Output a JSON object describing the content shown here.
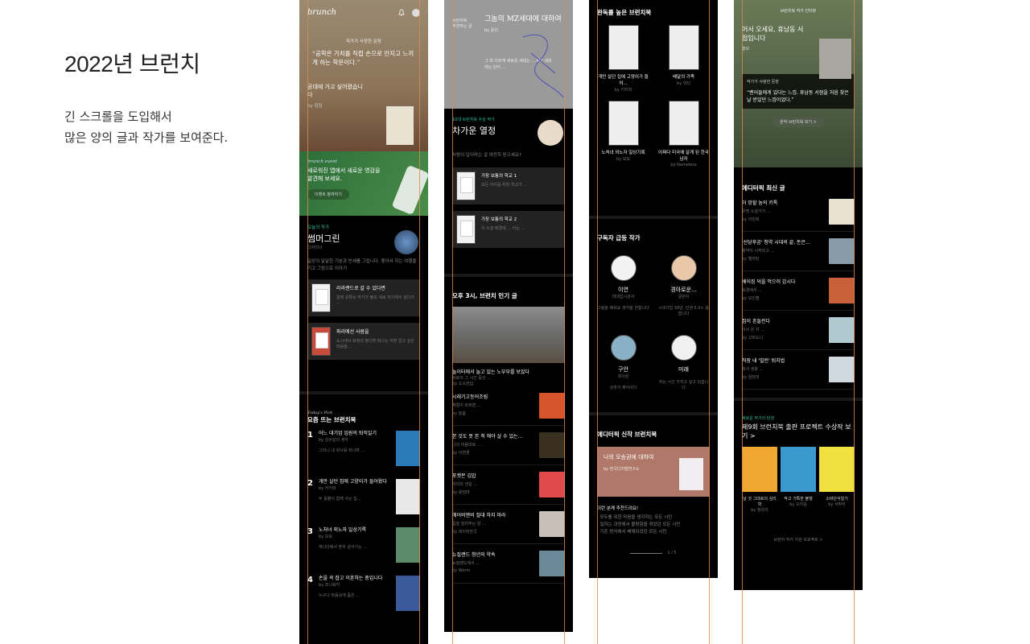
{
  "intro": {
    "title": "2022년 브런치",
    "lines": [
      "긴 스크롤을 도입해서",
      "많은 양의 글과 작가를 보여준다."
    ]
  },
  "col1": {
    "logo": "brunch",
    "hero_tag": "작가가 사랑한 문장",
    "hero_quote": "“공학은 가치를 직접 손으로 만지고 느끼게 하는 학문이다.”",
    "hero_sub": "공대에 가고 싶어졌습니다",
    "hero_author": "by 킴킴",
    "event_tag": "brunch event",
    "event_title": "새로워진 앱에서 새로운 영감을 발견해 보세요.",
    "event_btn": "이벤트 참여하기",
    "today_tag": "오늘의 작가",
    "today_name": "썸머그린",
    "today_job": "디자이너",
    "today_desc": "일상의 달달한 기분과 빈세를 그립니다. 좋아서 하는 여행을 기고 그림으로 이야기",
    "cards": [
      {
        "title": "라라랜드로 갈 수 있다면",
        "desc": "일에 유튜브 작가가 불쑥 새로 여기에서 살다가 ..."
      },
      {
        "title": "파리에선 사람을",
        "desc": "도시에서 표정의 참다면 떠나는 어떤 알고 싶은 마음을..."
      }
    ],
    "pick_tag": "Today's Pick",
    "pick_title": "요즘 뜨는 브런치북",
    "picks": [
      {
        "n": "1",
        "title": "어느 대기업 임원의 퇴직일기",
        "by": "by 김수달의 생각",
        "desc": "그러니 내 회사를 떠나며 ..."
      },
      {
        "n": "2",
        "title": "개만 살던 집에 고양이가 들어왔다",
        "by": "by 키키와",
        "desc": "두 동물이 함께 사는 집..."
      },
      {
        "n": "3",
        "title": "노처녀 외노자 일상기록",
        "by": "by 모모",
        "desc": "캐나다에서 혼자 살아가는 ..."
      },
      {
        "n": "4",
        "title": "손을 꼭 잡고 이혼하는 중입니다",
        "by": "by 조니워커",
        "desc": "누구나 마음속에 품은 ..."
      }
    ]
  },
  "col2": {
    "hero_small1": "브런치북",
    "hero_small2": "추천하는 글",
    "hero_title": "그놈의 MZ세대에 대하여",
    "hero_author": "by 윤리",
    "hero_desc": "그 회 다르게 새로운 세대는 ... MZ 세대라는 단어 ...",
    "award_tag": "10대 브런치북 수상 작가",
    "award_name": "차가운 열정",
    "award_q": "사람이 답이라는 걸 여전히 믿으세요?",
    "cards": [
      {
        "title": "가장 보통의 학교 1",
        "desc": "모든 아이를 위한 학교가 ..."
      },
      {
        "title": "가장 보통의 학교 2",
        "desc": "이 소설 배경에 ... 라는 ..."
      }
    ],
    "pop_title": "오후 3시, 브런치 인기 글",
    "pop_main": "놀이터에서 놀고 있는 노부부를 보았다",
    "pop_main_desc": "서로의 그 시간 동안 ...",
    "pop_main_by": "by 오소한집",
    "items": [
      {
        "title": "시래기고등어조림",
        "desc": "계절이 바뀌면 ...",
        "by": "by 늘봄"
      },
      {
        "title": "본 것도 못 본 척 해야 살 수 있는...",
        "desc": "나의 마음대로 ...",
        "by": "by 이연경"
      },
      {
        "title": "포켓몬 김밥",
        "desc": "아이의 생일 ...",
        "by": "by 용엄마"
      },
      {
        "title": "에어비앤비 절대 하지 마라",
        "desc": "집을 빌려주는 일 ...",
        "by": "by 데이빗한국"
      },
      {
        "title": "뉴질랜드 청년의 약속",
        "desc": "뉴질랜드에서 ...",
        "by": "by Worm"
      }
    ]
  },
  "col3": {
    "done_title": "완독률 높은 브런치북",
    "books": [
      {
        "title": "개만 살던 집에 고양이가 들어...",
        "by": "by 키키와"
      },
      {
        "title": "배달의 가족",
        "by": "by 빅터"
      },
      {
        "title": "노처녀 외노자 일상기록",
        "by": "by 모모"
      },
      {
        "title": "어쩌다 미국에 살게 된 한국 남자",
        "by": "by Nameless"
      }
    ],
    "sub_title": "구독자 급등 작가",
    "writers": [
      {
        "name": "이연",
        "job": "미대입시강사",
        "desc": "그림을 배워요 생각을 전합니다"
      },
      {
        "name": "경아로운...",
        "job": "글쓴이",
        "desc": "<대기업 30년, 인생 5.0> 를 씁니다"
      },
      {
        "name": "구안",
        "job": "회사원",
        "desc": "상추가 채식이다"
      },
      {
        "name": "미래",
        "job": "",
        "desc": "자는 시간 가지고 싶고 있습니다"
      }
    ],
    "new_title": "에디터픽 신작 브런치북",
    "new_book": "나의 오송권에 대하여",
    "new_by": "by 한국디지털연구소",
    "rec_head": "이런 분께 추천드려요!",
    "rec": [
      "· 모두를 위한 마음을 생각하는 모든 시민",
      "· 일하는 과정에서 불편함을 겪었던 모든 시민",
      "· 기존 방식에서 배제되었던 모든 시민"
    ],
    "pager": "1 / 5"
  },
  "col4": {
    "hero_tag": "브런치북 작가 인터뷰",
    "hero_title": "어서 오세요, 휴남동 서점입니다",
    "hero_by": "황보",
    "quote_tag": "작가가 사랑한 문장",
    "quote": "“벤어들에게 있다는 느낌. 휴남동 서점을 처음 찾은 날 받았던 느낌이었다.”",
    "quote_btn": "원작 브런치북 보기 >",
    "latest_title": "에디터픽 최신 글",
    "latest": [
      {
        "title": "이 망할 놈의 키톡",
        "desc": "유명 소설가가 ...",
        "by": "by 이민희"
      },
      {
        "title": "'선당후곰' 청약 시대의 끝, 돈은...",
        "desc": "청약이 시작되고 ...",
        "by": "by 엘라틴"
      },
      {
        "title": "베이징 덕을 먹으러 갑시다",
        "desc": "북경에서 ...",
        "by": "by 모인젬"
      },
      {
        "title": "집이 흔들린다",
        "desc": "이사 온 지 ...",
        "by": "by 고트도니"
      },
      {
        "title": "직장 내 '빌런' 퇴치법",
        "desc": "회사 생활 ...",
        "by": "by 임당미"
      }
    ],
    "award_tag": "새로운 작가의 탄생",
    "award_title": "제9회 브런치북 출판 프로젝트 수상작 보기 >",
    "award_books": [
      {
        "title": "날 것 그대로의 심리학",
        "by": "by 정유리"
      },
      {
        "title": "작고 기특한 불행",
        "by": "by 오지윤"
      },
      {
        "title": "소비단식일기",
        "by": "by 서박하"
      }
    ],
    "footer": "브런치 작가 지원 프로젝트 >"
  },
  "colors": {
    "accent": "#35c2a0",
    "guide": "#e08a4e",
    "bg": "#000000"
  }
}
